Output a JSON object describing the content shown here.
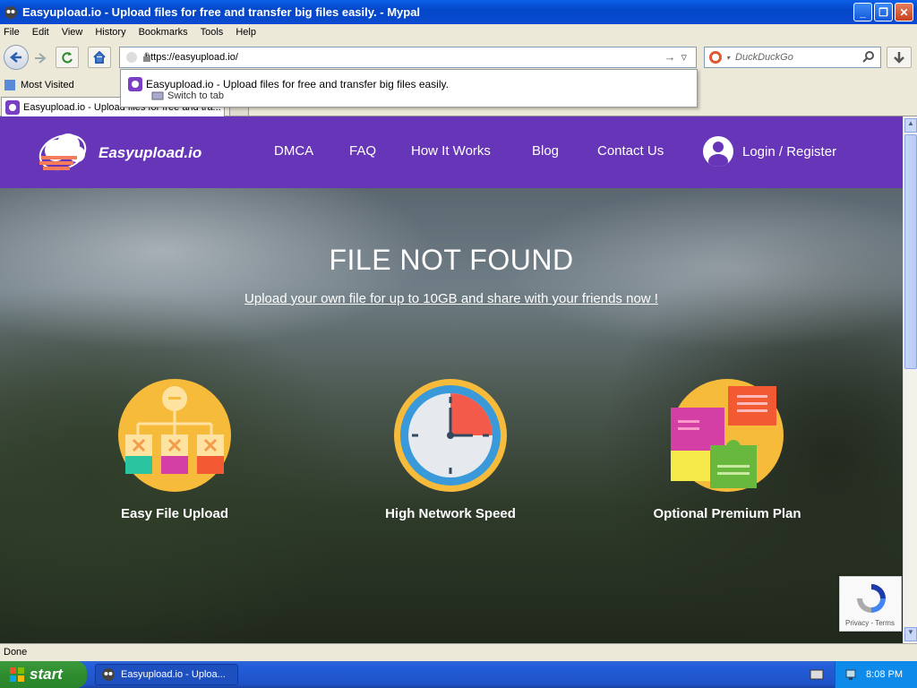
{
  "window": {
    "title": "Easyupload.io - Upload files for free and transfer big files easily. - Mypal"
  },
  "menu": [
    "File",
    "Edit",
    "View",
    "History",
    "Bookmarks",
    "Tools",
    "Help"
  ],
  "address": {
    "url": "https://easyupload.io/"
  },
  "search": {
    "placeholder": "DuckDuckGo"
  },
  "suggestion": {
    "title": "Easyupload.io - Upload files for free and transfer big files easily.",
    "action": "Switch to tab"
  },
  "bookmarks": {
    "most_visited": "Most Visited"
  },
  "tab": {
    "title": "Easyupload.io - Upload files for free and tra..."
  },
  "site": {
    "logo": "Easyupload.io",
    "nav": [
      "DMCA",
      "FAQ",
      "How It Works",
      "Blog",
      "Contact Us"
    ],
    "login": "Login / Register",
    "hero_title": "FILE NOT FOUND",
    "hero_sub": "Upload your own file for up to 10GB and share with your friends now !",
    "features": [
      "Easy File Upload",
      "High Network Speed",
      "Optional Premium Plan"
    ],
    "recaptcha": "Privacy - Terms"
  },
  "status": {
    "text": "Done"
  },
  "taskbar": {
    "start": "start",
    "task": "Easyupload.io - Uploa...",
    "clock": "8:08 PM"
  }
}
